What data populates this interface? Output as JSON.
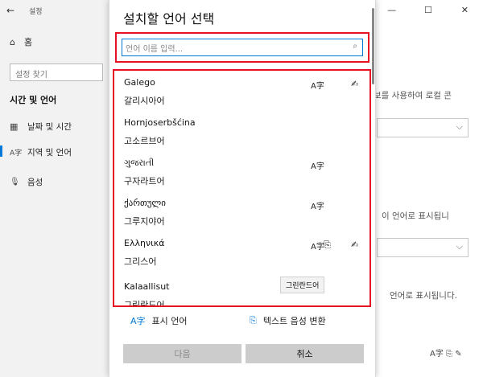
{
  "background": {
    "back_arrow": "←",
    "title": "설정",
    "home_icon": "⌂",
    "home_label": "홈",
    "search_placeholder": "설정 찾기",
    "section_heading": "시간 및 언어",
    "nav": [
      {
        "icon": "▦",
        "label": "날짜 및 시간"
      },
      {
        "icon": "A字",
        "label": "지역 및 언어"
      },
      {
        "icon": "🎙",
        "label": "음성"
      }
    ],
    "window_controls": {
      "minimize": "—",
      "maximize": "☐",
      "close": "✕"
    },
    "text_line1": "보를 사용하여 로컬 콘",
    "text_line2": "이 언어로 표시됩니",
    "text_line3": "언어로 표시됩니다.",
    "chevron": "⌵",
    "feature_icons": "A字  ⎘  ✎"
  },
  "dialog": {
    "title": "설치할 언어 선택",
    "search": {
      "placeholder": "언어 이름 입력...",
      "icon": "⌕",
      "value": ""
    },
    "languages": [
      {
        "name": "Galego",
        "sub": "갈리시아어",
        "a": "A字",
        "t": "",
        "h": "✍"
      },
      {
        "name": "Hornjoserbšćina",
        "sub": "고소르브어",
        "a": "",
        "t": "",
        "h": ""
      },
      {
        "name": "ગુજરાતી",
        "sub": "구자라트어",
        "a": "A字",
        "t": "",
        "h": ""
      },
      {
        "name": "ქართული",
        "sub": "그루지야어",
        "a": "A字",
        "t": "",
        "h": ""
      },
      {
        "name": "Ελληνικά",
        "sub": "그리스어",
        "a": "A字",
        "t": "⎘",
        "h": "✍"
      },
      {
        "name": "Kalaallisut",
        "sub": "그린란드어",
        "a": "",
        "t": "",
        "h": ""
      }
    ],
    "tooltip": "그린란드어",
    "legend": {
      "display_icon": "A字",
      "display_label": "표시 언어",
      "tts_icon": "⎘",
      "tts_label": "텍스트 음성 변환"
    },
    "next_label": "다음",
    "cancel_label": "취소"
  }
}
